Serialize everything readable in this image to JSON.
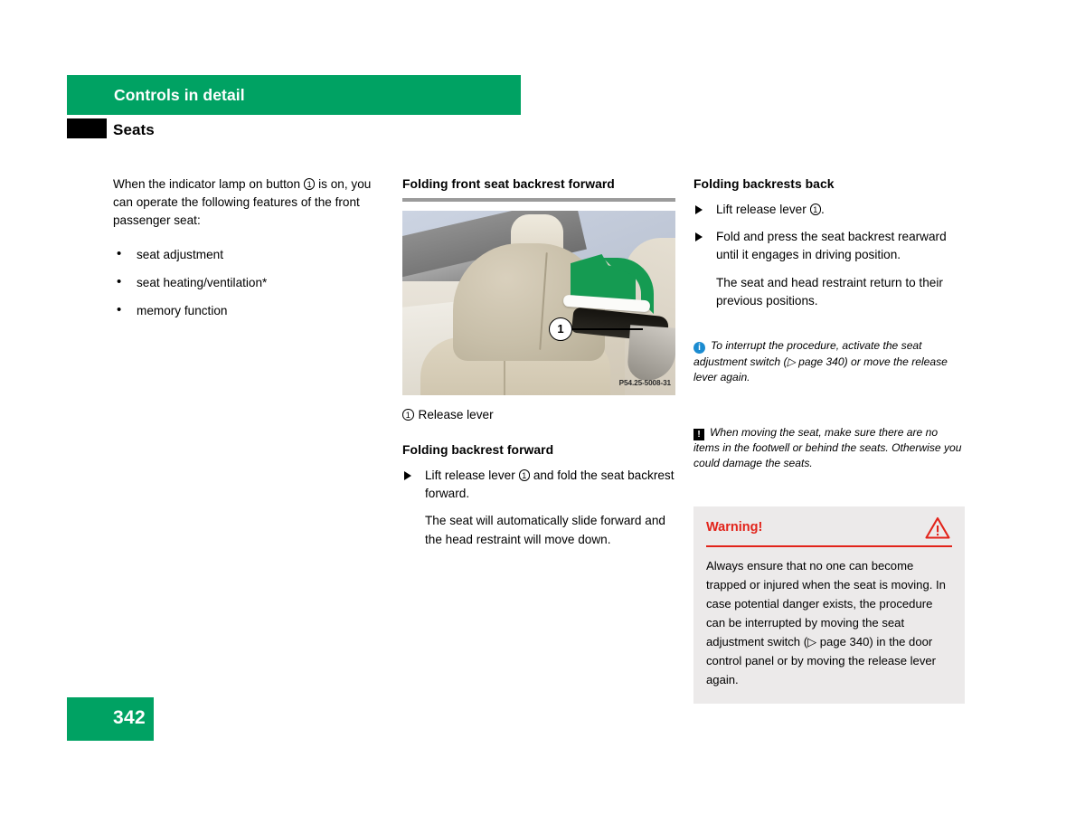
{
  "header": {
    "chapter": "Controls in detail",
    "section": "Seats"
  },
  "left_column": {
    "intro_line1": "When the indicator lamp on button",
    "intro_marker": "1",
    "intro_line2": "is on, you can operate the following features of the front passenger seat:",
    "bullets": [
      "seat adjustment",
      "seat heating/ventilation*",
      "memory function"
    ]
  },
  "middle_column": {
    "heading": "Folding front seat backrest forward",
    "figure": {
      "callout_number": "1",
      "image_code": "P54.25-5008-31",
      "caption_marker": "1",
      "caption_text": "Release lever"
    },
    "subheading": "Folding backrest forward",
    "step_marker": "1",
    "step_before": "Lift release lever",
    "step_after": "and fold the seat backrest forward.",
    "result": "The seat will automatically slide forward and the head restraint will move down."
  },
  "right_column": {
    "heading": "Folding backrests back",
    "step1_before": "Lift release lever",
    "step1_marker": "1",
    "step1_after": ".",
    "step2": "Fold and press the seat backrest rearward until it engages in driving position.",
    "step2_result": "The seat and head restraint return to their previous positions.",
    "info_note": "To interrupt the procedure, activate the seat adjustment switch (▷ page 340) or move the release lever again.",
    "info_icon_glyph": "i",
    "caution_note": "When moving the seat, make sure there are no items in the footwell or behind the seats. Otherwise you could damage the seats.",
    "caution_icon_glyph": "!",
    "warning": {
      "title": "Warning!",
      "body": "Always ensure that no one can become trapped or injured when the seat is moving. In case potential danger exists, the procedure can be interrupted by moving the seat adjustment switch (▷ page 340) in the door control panel or by moving the release lever again."
    }
  },
  "footer": {
    "page_number": "342"
  },
  "colors": {
    "brand_green": "#00a263",
    "warning_red": "#e2231a",
    "info_blue": "#1b8bd0",
    "rule_gray": "#9b9b9b",
    "warn_box_bg": "#eceaea"
  }
}
